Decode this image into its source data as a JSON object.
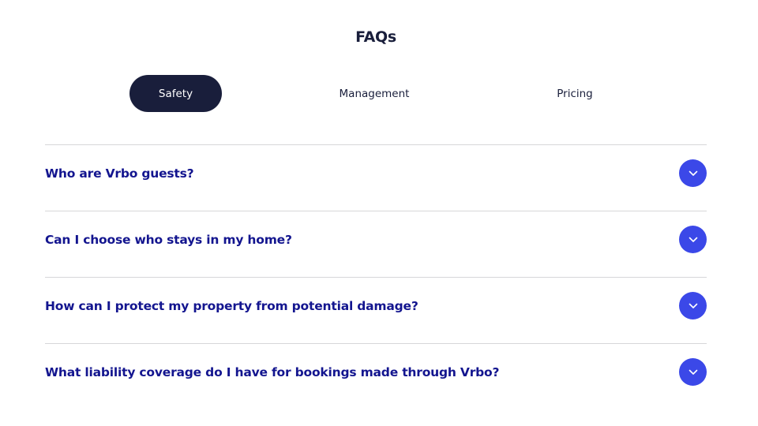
{
  "page": {
    "title": "FAQs"
  },
  "tabs": [
    {
      "label": "Safety",
      "active": true
    },
    {
      "label": "Management",
      "active": false
    },
    {
      "label": "Pricing",
      "active": false
    }
  ],
  "faqs": [
    {
      "question": "Who are Vrbo guests?",
      "icon": "chevron-down-icon"
    },
    {
      "question": "Can I choose who stays in my home?",
      "icon": "chevron-down-icon"
    },
    {
      "question": "How can I protect my property from potential damage?",
      "icon": "chevron-down-icon"
    },
    {
      "question": "What liability coverage do I have for bookings made through Vrbo?",
      "icon": "chevron-down-icon"
    }
  ],
  "colors": {
    "active_tab_bg": "#191e3b",
    "question_text": "#13158f",
    "toggle_bg": "#3b48e8",
    "divider": "#d7d7d9"
  }
}
